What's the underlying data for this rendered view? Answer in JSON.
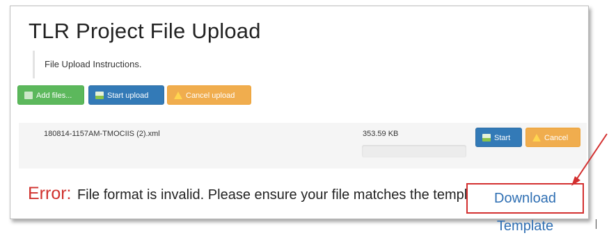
{
  "page": {
    "title": "TLR Project File Upload",
    "instructions": "File Upload Instructions."
  },
  "toolbar": {
    "add_files_label": "Add files...",
    "start_upload_label": "Start upload",
    "cancel_upload_label": "Cancel upload"
  },
  "file": {
    "name": "180814-1157AM-TMOCIIS (2).xml",
    "size": "353.59 KB",
    "progress_percent": 0,
    "start_label": "Start",
    "cancel_label": "Cancel"
  },
  "error": {
    "label": "Error:",
    "message": "File format is invalid. Please ensure your file matches the template.",
    "link_label": "Download Template"
  },
  "colors": {
    "success": "#5cb85c",
    "primary": "#337ab7",
    "warning": "#f0ad4e",
    "error": "#d0312d",
    "link": "#2f6fb3",
    "highlight": "#d32f2f"
  }
}
